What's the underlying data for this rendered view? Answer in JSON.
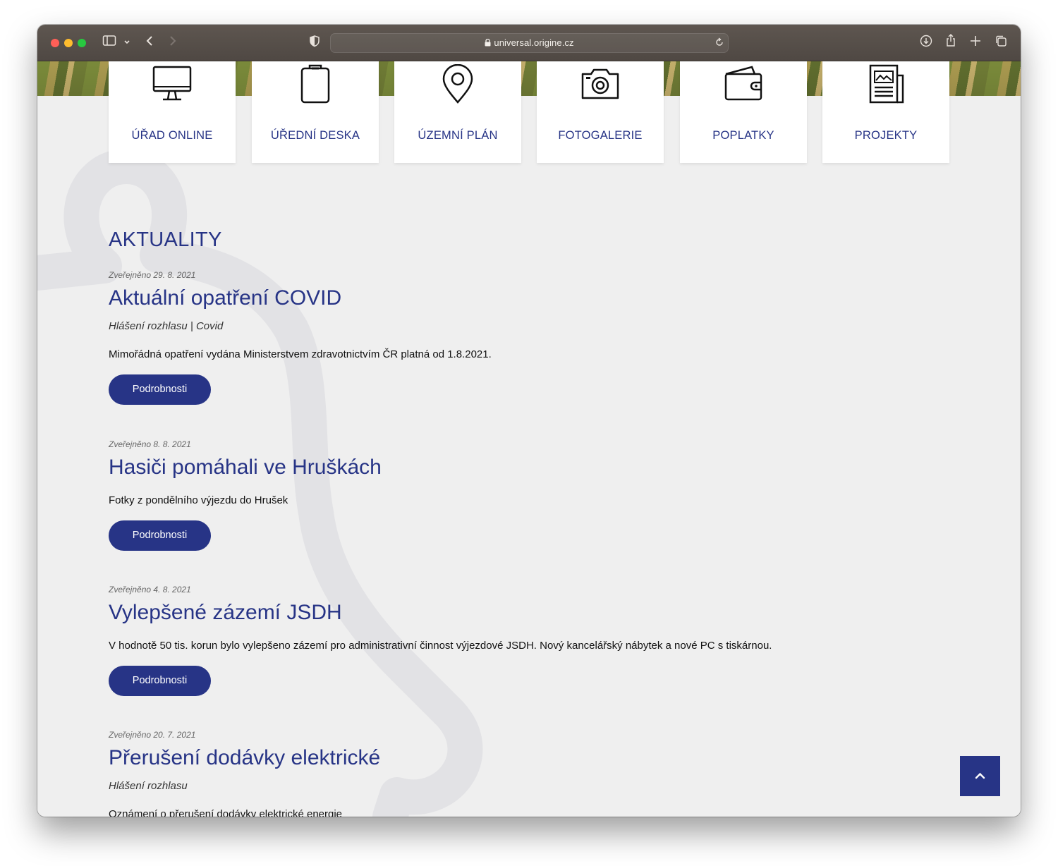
{
  "browser": {
    "url": "universal.origine.cz",
    "colors": {
      "close": "#ff5f57",
      "minimize": "#febc2e",
      "zoom": "#28c840"
    }
  },
  "quick_links": [
    {
      "label": "ÚŘAD ONLINE",
      "icon": "monitor-icon"
    },
    {
      "label": "ÚŘEDNÍ DESKA",
      "icon": "clipboard-icon"
    },
    {
      "label": "ÚZEMNÍ PLÁN",
      "icon": "map-pin-icon"
    },
    {
      "label": "FOTOGALERIE",
      "icon": "camera-icon"
    },
    {
      "label": "POPLATKY",
      "icon": "wallet-icon"
    },
    {
      "label": "PROJEKTY",
      "icon": "newspaper-icon"
    }
  ],
  "news": {
    "title": "AKTUALITY",
    "articles": [
      {
        "date": "Zveřejněno 29. 8. 2021",
        "title": "Aktuální opatření COVID",
        "tags": "Hlášení rozhlasu | Covid",
        "excerpt": "Mimořádná opatření vydána Ministerstvem zdravotnictvím ČR platná od 1.8.2021.",
        "button": "Podrobnosti"
      },
      {
        "date": "Zveřejněno 8. 8. 2021",
        "title": "Hasiči pomáhali ve Hruškách",
        "excerpt": "Fotky z pondělního výjezdu do Hrušek",
        "button": "Podrobnosti"
      },
      {
        "date": "Zveřejněno 4. 8. 2021",
        "title": "Vylepšené zázemí JSDH",
        "excerpt": "V hodnotě 50 tis. korun bylo vylepšeno zázemí pro administrativní činnost výjezdové JSDH. Nový kancelářský nábytek a nové PC s tiskárnou.",
        "button": "Podrobnosti"
      },
      {
        "date": "Zveřejněno 20. 7. 2021",
        "title": "Přerušení dodávky elektrické",
        "tags": "Hlášení rozhlasu",
        "excerpt": "Oznámení o přerušení dodávky elektrické energie"
      }
    ]
  },
  "theme": {
    "primary": "#273486",
    "background": "#efefef"
  },
  "back_to_top_icon": "chevron-up-icon"
}
